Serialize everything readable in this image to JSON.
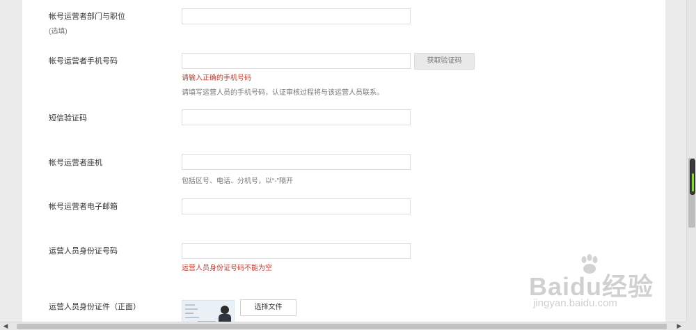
{
  "form": {
    "dept": {
      "label": "帐号运营者部门与职位",
      "sublabel": "(选填)",
      "value": ""
    },
    "phone": {
      "label": "帐号运营者手机号码",
      "value": "",
      "get_code_button": "获取验证码",
      "error": "请输入正确的手机号码",
      "hint": "请填写运营人员的手机号码，认证审核过程将与该运营人员联系。"
    },
    "sms": {
      "label": "短信验证码",
      "value": ""
    },
    "landline": {
      "label": "帐号运营者座机",
      "value": "",
      "hint": "包括区号、电话、分机号，以“-”隔开"
    },
    "email": {
      "label": "帐号运营者电子邮箱",
      "value": ""
    },
    "id_number": {
      "label": "运营人员身份证号码",
      "value": "",
      "error": "运营人员身份证号码不能为空"
    },
    "id_front": {
      "label": "运营人员身份证件（正面）",
      "choose_button": "选择文件"
    }
  },
  "watermark": {
    "logo": "Baidu经验",
    "url": "jingyan.baidu.com"
  },
  "colors": {
    "error": "#c0392b",
    "hint": "#777777",
    "border": "#dedede"
  }
}
